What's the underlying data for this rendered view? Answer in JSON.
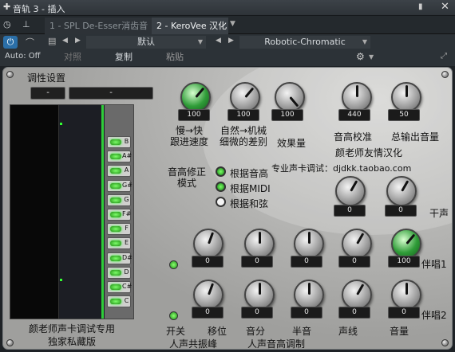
{
  "titlebar": {
    "title": "音轨 3 - 插入"
  },
  "tabs": [
    "1 - SPL De-Esser消齿音",
    "2 - KeroVee 汉化"
  ],
  "toolbar": {
    "preset": "默认",
    "preset2": "Robotic-Chromatic",
    "auto": "Auto: Off",
    "compare": "对照",
    "copy": "复制",
    "paste": "粘贴"
  },
  "panel": {
    "scale_title": "调性设置",
    "scale_fields": [
      "-",
      "-"
    ],
    "keys": [
      "B",
      "A#",
      "A",
      "G#",
      "G",
      "F#",
      "F",
      "E",
      "D#",
      "D",
      "C#",
      "C"
    ],
    "top_knobs": [
      {
        "value": "100",
        "label": "慢→快\n跟进速度"
      },
      {
        "value": "100",
        "label": "自然→机械\n细微的差别"
      },
      {
        "value": "100",
        "label": "效果量"
      }
    ],
    "right_knobs": [
      {
        "value": "440",
        "label": "音高校准"
      },
      {
        "value": "50",
        "label": "总输出音量"
      }
    ],
    "credit1": "颜老师友情汉化",
    "credit2": "专业声卡调试：djdkk.taobao.com",
    "mode_label": "音高修正\n模式",
    "modes": [
      "根据音高",
      "根据MIDI",
      "根据和弦"
    ],
    "dry_values": [
      "0",
      "0"
    ],
    "dry_label": "干声",
    "harm1_values": [
      "0",
      "0",
      "0",
      "0",
      "100"
    ],
    "harm1_label": "伴唱1",
    "harm2_values": [
      "0",
      "0",
      "0",
      "0",
      "0"
    ],
    "harm2_label": "伴唱2",
    "bottom_left": "颜老师声卡调试专用\n独家私藏版",
    "col_labels": [
      "开关",
      "移位",
      "音分",
      "半音",
      "声线",
      "音量"
    ],
    "group_labels": [
      "人声共振峰",
      "人声音高调制"
    ]
  }
}
